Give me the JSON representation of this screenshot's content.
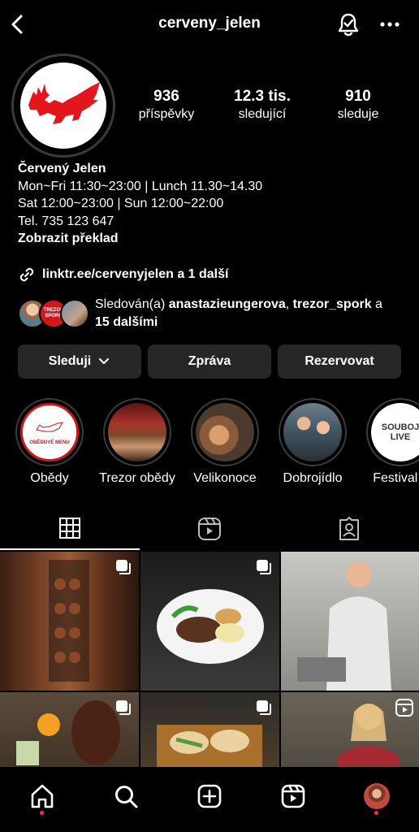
{
  "header": {
    "username": "cerveny_jelen"
  },
  "profile": {
    "stats": [
      {
        "num": "936",
        "label": "příspěvky"
      },
      {
        "num": "12.3 tis.",
        "label": "sledující"
      },
      {
        "num": "910",
        "label": "sleduje"
      }
    ],
    "name": "Červený Jelen",
    "bio_lines": [
      "Mon~Fri 11:30~23:00 | Lunch 11.30~14.30",
      "Sat 12:00~23:00 | Sun 12:00~22:00",
      "Tel. 735 123 647"
    ],
    "translate": "Zobrazit překlad",
    "link": "linktr.ee/cervenyjelen a 1 další",
    "followed_by": {
      "prefix": "Sledován(a) ",
      "user1": "anastazieungerova",
      "sep": ", ",
      "user2": "trezor_spork",
      "mid": " a",
      "rest": "15 dalšími"
    }
  },
  "buttons": {
    "follow": "Sleduji",
    "message": "Zpráva",
    "reserve": "Rezervovat"
  },
  "highlights": [
    {
      "label": "Obědy",
      "inner_text": "OBĚDOVÉ MENU"
    },
    {
      "label": "Trezor obědy"
    },
    {
      "label": "Velikonoce"
    },
    {
      "label": "Dobrojídlo"
    },
    {
      "label": "Festival c",
      "inner_text": "SOUBOJ LIVE"
    }
  ],
  "avatar_badge": "TREZOR SPORK",
  "colors": {
    "brand_red": "#e3161b",
    "button_bg": "#262626",
    "notification_dot": "#ff3040"
  },
  "nav": {
    "items": [
      "home-icon",
      "search-icon",
      "create-icon",
      "reels-icon",
      "profile-avatar"
    ]
  }
}
